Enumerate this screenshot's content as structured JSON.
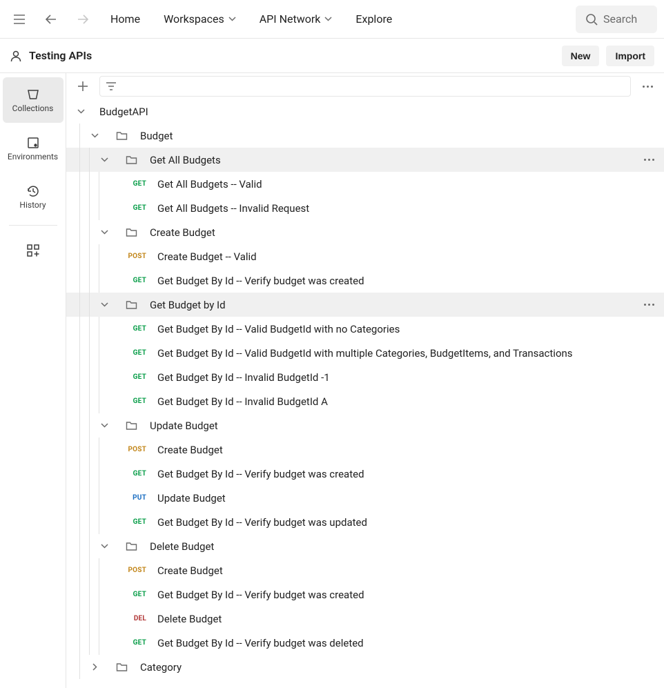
{
  "topnav": {
    "home": "Home",
    "workspaces": "Workspaces",
    "apiNetwork": "API Network",
    "explore": "Explore",
    "searchPlaceholder": "Search"
  },
  "workspace": {
    "title": "Testing APIs",
    "newBtn": "New",
    "importBtn": "Import"
  },
  "rail": {
    "collections": "Collections",
    "environments": "Environments",
    "history": "History"
  },
  "tree": {
    "root": "BudgetAPI",
    "groups": [
      {
        "name": "Budget",
        "folders": [
          {
            "name": "Get All Budgets",
            "selected": true,
            "requests": [
              {
                "method": "GET",
                "name": "Get All Budgets -- Valid"
              },
              {
                "method": "GET",
                "name": "Get All Budgets -- Invalid Request"
              }
            ]
          },
          {
            "name": "Create Budget",
            "requests": [
              {
                "method": "POST",
                "name": "Create Budget -- Valid"
              },
              {
                "method": "GET",
                "name": "Get Budget By Id -- Verify budget was created"
              }
            ]
          },
          {
            "name": "Get Budget by Id",
            "selected": true,
            "showMore": true,
            "requests": [
              {
                "method": "GET",
                "name": "Get Budget By Id -- Valid BudgetId with no Categories"
              },
              {
                "method": "GET",
                "name": "Get Budget By Id -- Valid BudgetId with multiple Categories, BudgetItems, and Transactions"
              },
              {
                "method": "GET",
                "name": "Get Budget By Id -- Invalid BudgetId -1"
              },
              {
                "method": "GET",
                "name": "Get Budget By Id -- Invalid BudgetId A"
              }
            ]
          },
          {
            "name": "Update Budget",
            "requests": [
              {
                "method": "POST",
                "name": "Create Budget"
              },
              {
                "method": "GET",
                "name": "Get Budget By Id -- Verify budget was created"
              },
              {
                "method": "PUT",
                "name": "Update Budget"
              },
              {
                "method": "GET",
                "name": "Get Budget By Id -- Verify budget was updated"
              }
            ]
          },
          {
            "name": "Delete Budget",
            "requests": [
              {
                "method": "POST",
                "name": "Create Budget"
              },
              {
                "method": "GET",
                "name": "Get Budget By Id -- Verify budget was created"
              },
              {
                "method": "DEL",
                "name": "Delete Budget"
              },
              {
                "method": "GET",
                "name": "Get Budget By Id -- Verify budget was deleted"
              }
            ]
          }
        ]
      },
      {
        "name": "Category",
        "collapsed": true
      }
    ]
  }
}
